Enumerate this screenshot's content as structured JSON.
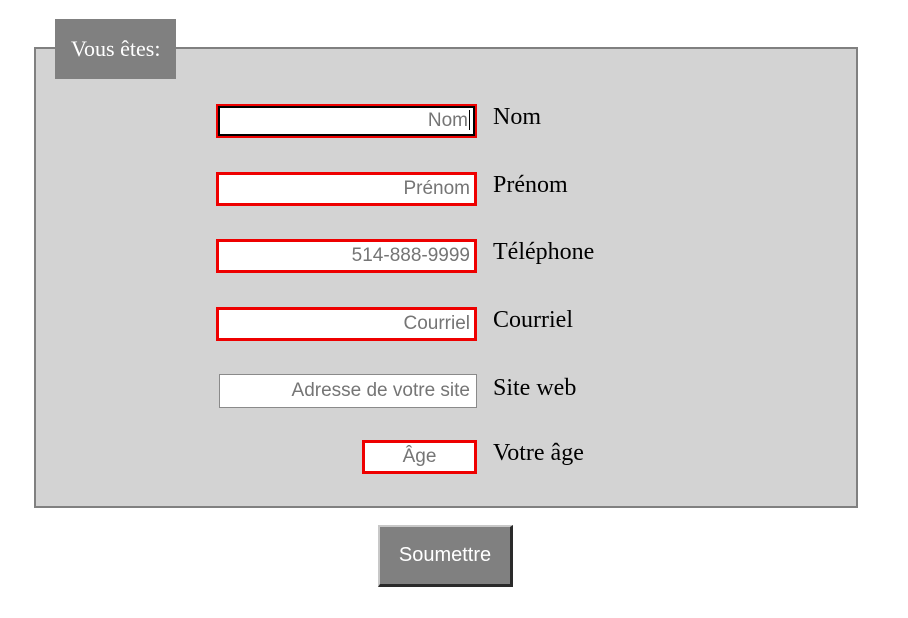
{
  "form": {
    "legend": "Vous êtes:",
    "fields": [
      {
        "label": "Nom",
        "placeholder": "Nom",
        "state": "invalid-focused"
      },
      {
        "label": "Prénom",
        "placeholder": "Prénom",
        "state": "invalid"
      },
      {
        "label": "Téléphone",
        "placeholder": "514-888-9999",
        "state": "invalid"
      },
      {
        "label": "Courriel",
        "placeholder": "Courriel",
        "state": "invalid"
      },
      {
        "label": "Site web",
        "placeholder": "Adresse de votre site",
        "state": "valid"
      },
      {
        "label": "Votre âge",
        "placeholder": "Âge",
        "state": "invalid"
      }
    ],
    "submit_label": "Soumettre"
  },
  "colors": {
    "panel_background": "#d3d3d3",
    "panel_border": "#808080",
    "legend_background": "#808080",
    "invalid_border": "#ee0000",
    "button_background": "#808080",
    "placeholder_text": "#757575"
  }
}
